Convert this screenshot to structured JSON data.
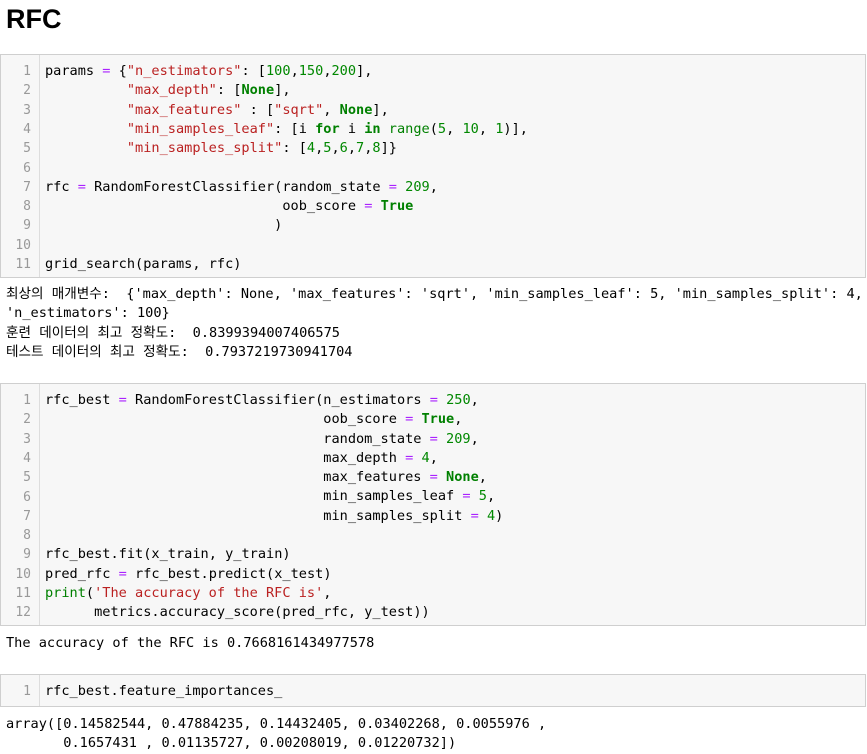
{
  "heading": "RFC",
  "cells": [
    {
      "line_numbers": [
        "1",
        "2",
        "3",
        "4",
        "5",
        "6",
        "7",
        "8",
        "9",
        "10",
        "11"
      ],
      "lines": [
        "params = {\"n_estimators\": [100,150,200],",
        "          \"max_depth\": [None],",
        "          \"max_features\" : [\"sqrt\", None],",
        "          \"min_samples_leaf\": [i for i in range(5, 10, 1)],",
        "          \"min_samples_split\": [4,5,6,7,8]}",
        "",
        "rfc = RandomForestClassifier(random_state = 209,",
        "                             oob_score = True",
        "                            )",
        "",
        "grid_search(params, rfc)"
      ],
      "output": [
        "최상의 매개변수:  {'max_depth': None, 'max_features': 'sqrt', 'min_samples_leaf': 5, 'min_samples_split': 4,",
        "'n_estimators': 100}",
        "훈련 데이터의 최고 정확도:  0.8399394007406575",
        "테스트 데이터의 최고 정확도:  0.7937219730941704"
      ]
    },
    {
      "line_numbers": [
        "1",
        "2",
        "3",
        "4",
        "5",
        "6",
        "7",
        "8",
        "9",
        "10",
        "11",
        "12"
      ],
      "lines": [
        "rfc_best = RandomForestClassifier(n_estimators = 250,",
        "                                  oob_score = True,",
        "                                  random_state = 209,",
        "                                  max_depth = 4,",
        "                                  max_features = None,",
        "                                  min_samples_leaf = 5,",
        "                                  min_samples_split = 4)",
        "",
        "rfc_best.fit(x_train, y_train)",
        "pred_rfc = rfc_best.predict(x_test)",
        "print('The accuracy of the RFC is',",
        "      metrics.accuracy_score(pred_rfc, y_test))"
      ],
      "output": [
        "The accuracy of the RFC is 0.7668161434977578"
      ]
    },
    {
      "line_numbers": [
        "1"
      ],
      "lines": [
        "rfc_best.feature_importances_"
      ],
      "output": [
        "array([0.14582544, 0.47884235, 0.14432405, 0.03402268, 0.0055976 ,",
        "       0.1657431 , 0.01135727, 0.00208019, 0.01220732])"
      ]
    }
  ]
}
